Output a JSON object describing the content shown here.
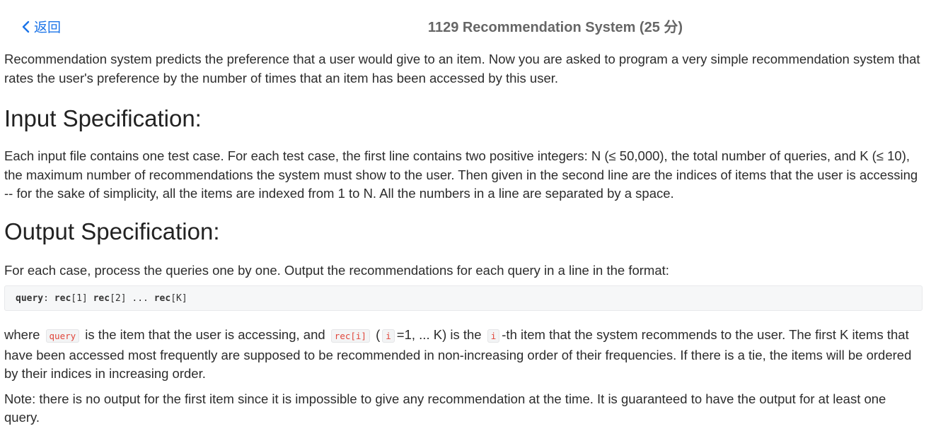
{
  "header": {
    "back_label": "返回",
    "title": "1129 Recommendation System (25 分)"
  },
  "intro": "Recommendation system predicts the preference that a user would give to an item. Now you are asked to program a very simple recommendation system that rates the user's preference by the number of times that an item has been accessed by this user.",
  "input_section": {
    "heading": "Input Specification:",
    "text": "Each input file contains one test case. For each test case, the first line contains two positive integers: N (≤ 50,000), the total number of queries, and K (≤ 10), the maximum number of recommendations the system must show to the user. Then given in the second line are the indices of items that the user is accessing -- for the sake of simplicity, all the items are indexed from 1 to N. All the numbers in a line are separated by a space."
  },
  "output_section": {
    "heading": "Output Specification:",
    "text": "For each case, process the queries one by one. Output the recommendations for each query in a line in the format:",
    "code": {
      "t1": "query",
      "t2": ": ",
      "t3": "rec",
      "t4": "[1] ",
      "t5": "rec",
      "t6": "[2] ... ",
      "t7": "rec",
      "t8": "[K]"
    },
    "where": {
      "s1": "where ",
      "c1": "query",
      "s2": " is the item that the user is accessing, and ",
      "c2": "rec[i]",
      "s3": " (",
      "c3": "i",
      "s4": "=1, ... K) is the ",
      "c4": "i",
      "s5": "-th item that the system recommends to the user. The first K items that have been accessed most frequently are supposed to be recommended in non-increasing order of their frequencies. If there is a tie, the items will be ordered by their indices in increasing order."
    },
    "note": "Note: there is no output for the first item since it is impossible to give any recommendation at the time. It is guaranteed to have the output for at least one query."
  },
  "colors": {
    "link": "#1a73e8",
    "title": "#666666",
    "inline_code": "#e0453a"
  },
  "icons": {
    "back": "chevron-left-icon"
  }
}
